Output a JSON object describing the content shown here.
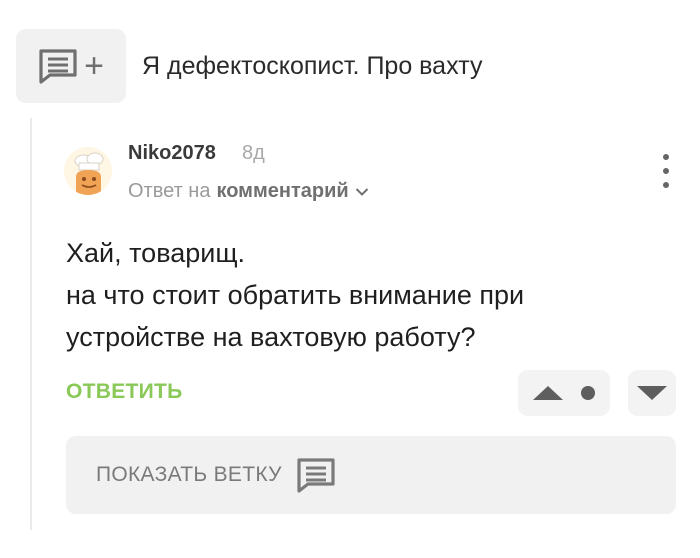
{
  "post": {
    "title": "Я дефектоскопист. Про вахту",
    "icon": "comment-add-icon",
    "plus": "+"
  },
  "comment": {
    "username": "Niko2078",
    "time": "8д",
    "reply_prefix": "Ответ на",
    "reply_target": "комментарий",
    "lines": [
      "Хай, товарищ.",
      "на что стоит обратить внимание при",
      "устройстве на вахтовую работу?"
    ],
    "reply_label": "ОТВЕТИТЬ",
    "show_thread_label": "ПОКАЗАТЬ ВЕТКУ"
  },
  "colors": {
    "accent_green": "#8ac858",
    "icon_gray": "#5e5e5e",
    "panel_bg": "#f1f1f1"
  }
}
